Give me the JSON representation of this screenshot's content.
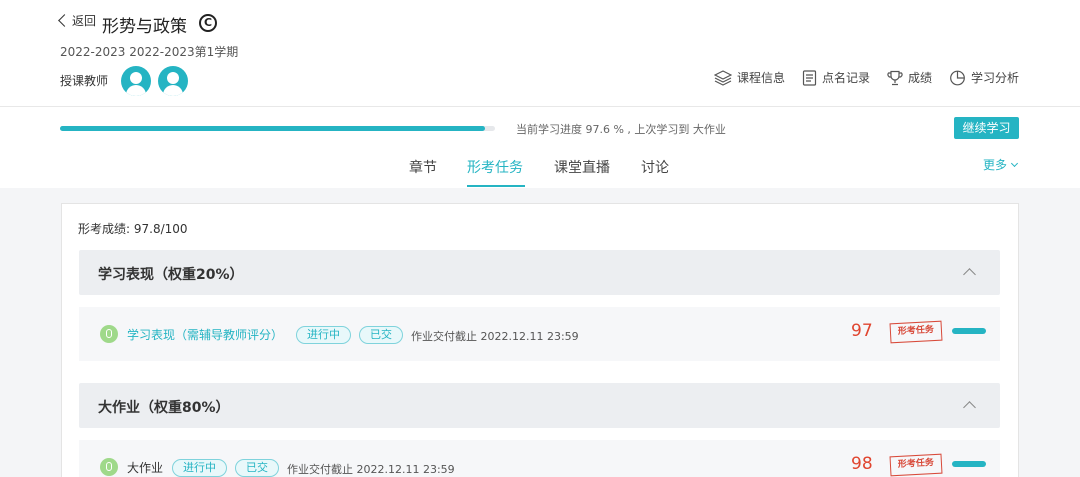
{
  "header": {
    "back_label": "返回",
    "course_title": "形势与政策",
    "copyright_symbol": "C",
    "term": "2022-2023 2022-2023第1学期",
    "teacher_label": "授课教师",
    "toolbar": [
      {
        "label": "课程信息",
        "icon": "layers-icon"
      },
      {
        "label": "点名记录",
        "icon": "document-icon"
      },
      {
        "label": "成绩",
        "icon": "trophy-icon"
      },
      {
        "label": "学习分析",
        "icon": "pie-chart-icon"
      }
    ]
  },
  "progress": {
    "value_percent": 97.6,
    "text": "当前学习进度 97.6 % , 上次学习到 大作业",
    "continue_label": "继续学习"
  },
  "tabs": [
    {
      "label": "章节",
      "active": false
    },
    {
      "label": "形考任务",
      "active": true
    },
    {
      "label": "课堂直播",
      "active": false
    },
    {
      "label": "讨论",
      "active": false
    }
  ],
  "more_label": "更多",
  "score_total": "形考成绩: 97.8/100",
  "sections": [
    {
      "title": "学习表现（权重20%）",
      "task": {
        "name": "学习表现（需辅导教师评分）",
        "status": "进行中",
        "submitted": "已交",
        "deadline": "作业交付截止 2022.12.11 23:59",
        "score": "97",
        "stamp": "形考任务",
        "progress_percent": 100
      }
    },
    {
      "title": "大作业（权重80%）",
      "task": {
        "name": "大作业",
        "status": "进行中",
        "submitted": "已交",
        "deadline": "作业交付截止 2022.12.11 23:59",
        "score": "98",
        "stamp": "形考任务",
        "progress_percent": 100
      }
    }
  ],
  "colors": {
    "accent": "#25b4c3",
    "score_red": "#e0452f",
    "task_icon_green": "#9fd98a"
  }
}
